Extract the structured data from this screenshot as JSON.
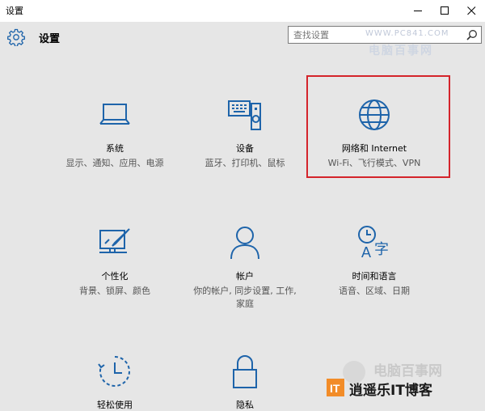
{
  "window": {
    "title": "设置"
  },
  "header": {
    "title": "设置"
  },
  "search": {
    "placeholder": "查找设置"
  },
  "watermark": {
    "site": "WWW.PC841.COM",
    "name": "电脑百事网",
    "bottom_name": "电脑百事网",
    "bottom_brand": "逍遥乐IT博客"
  },
  "tiles": [
    {
      "name": "系统",
      "desc": "显示、通知、应用、电源",
      "icon": "laptop-icon"
    },
    {
      "name": "设备",
      "desc": "蓝牙、打印机、鼠标",
      "icon": "devices-icon"
    },
    {
      "name": "网络和 Internet",
      "desc": "Wi-Fi、飞行模式、VPN",
      "icon": "globe-icon"
    },
    {
      "name": "个性化",
      "desc": "背景、锁屏、颜色",
      "icon": "personalization-icon"
    },
    {
      "name": "帐户",
      "desc": "你的帐户, 同步设置, 工作, 家庭",
      "icon": "person-icon"
    },
    {
      "name": "时间和语言",
      "desc": "语音、区域、日期",
      "icon": "time-language-icon"
    },
    {
      "name": "轻松使用",
      "desc": "",
      "icon": "ease-of-access-icon"
    },
    {
      "name": "隐私",
      "desc": "",
      "icon": "lock-icon"
    }
  ],
  "colors": {
    "accent": "#1e64aa",
    "highlight_border": "#d4242b"
  }
}
